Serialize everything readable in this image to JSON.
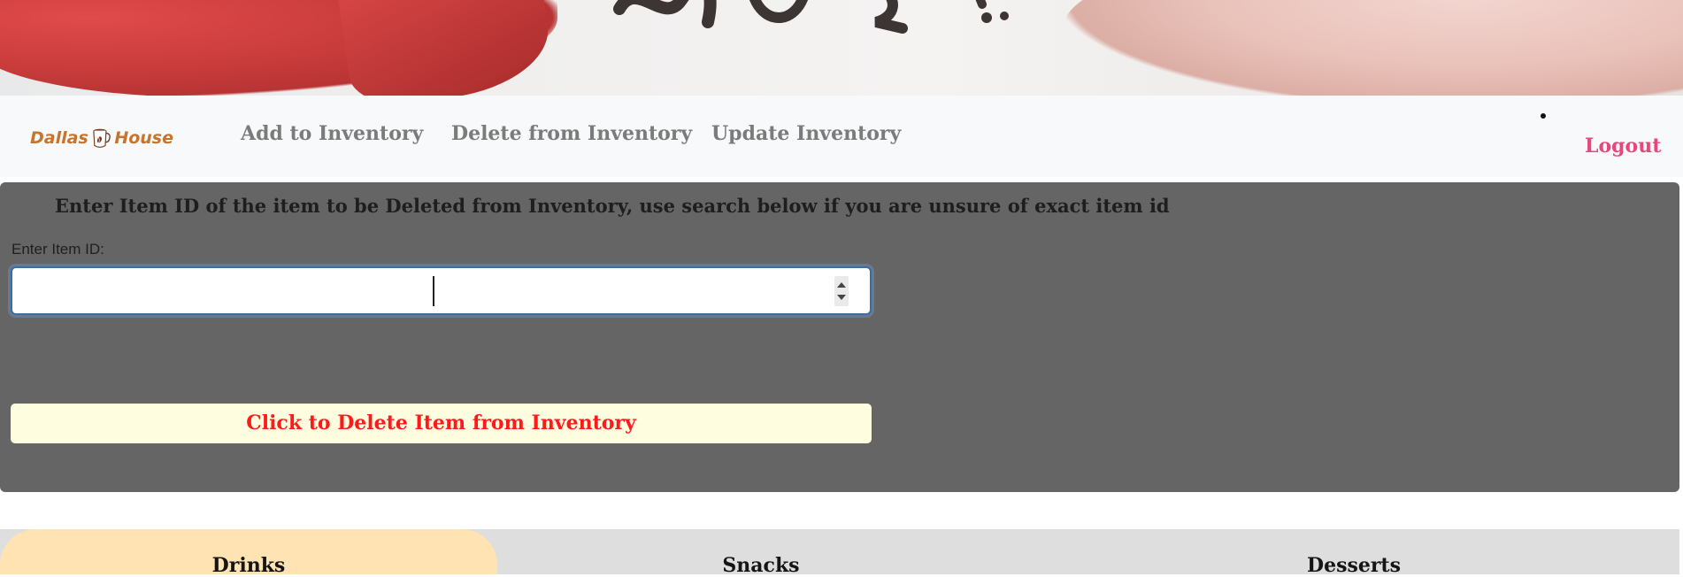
{
  "nav": {
    "logo": {
      "word1": "Dallas",
      "word2": "House",
      "icon": "coffee-mug-icon"
    },
    "links": [
      {
        "label": "Add to Inventory"
      },
      {
        "label": "Delete from Inventory"
      },
      {
        "label": "Update Inventory"
      }
    ],
    "logout": "Logout"
  },
  "panel": {
    "heading": "Enter Item ID of the item to be Deleted from Inventory, use search below if you are unsure of exact item id",
    "input_label": "Enter Item ID:",
    "input_value": "",
    "delete_button": "Click to Delete Item from Inventory"
  },
  "tabs": [
    {
      "label": "Drinks",
      "active": true
    },
    {
      "label": "Snacks",
      "active": false
    },
    {
      "label": "Desserts",
      "active": false
    }
  ],
  "colors": {
    "accent_orange": "#c7742c",
    "logout_pink": "#e8477c",
    "delete_red": "#ff1a1a",
    "panel_bg": "#656565",
    "active_tab": "#ffe3b2"
  }
}
